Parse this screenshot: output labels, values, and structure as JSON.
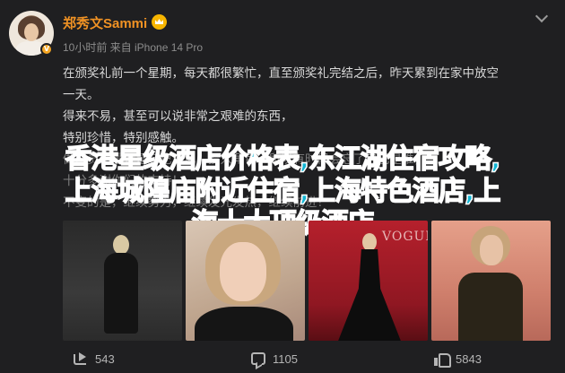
{
  "post": {
    "author": "郑秀文Sammi",
    "meta": "10小时前 来自 iPhone 14 Pro",
    "lines": [
      "在颁奖礼前一个星期，每天都很繁忙，直至颁奖礼完结之后，昨天累到在家中放空",
      "一天。",
      "得来不易，甚至可以说非常之艰难的东西，",
      "特别珍惜，特别感触。",
      "做演员最重要是忘记自己，投入角色，所以有时候会忘了自己是谁，",
      "十分多谢你们的支持！",
      "不变的是，继续努力，继续发光发热，继续前进！"
    ]
  },
  "overlay": {
    "line1": "香港星级酒店价格表,东江湖住宿攻略,",
    "line2": "上海城隍庙附近住宿,上海特色酒店,上",
    "line3": "海十大顶级酒店"
  },
  "photos": {
    "p3_brand": "VOGUE"
  },
  "actions": {
    "share_count": "543",
    "comment_count": "1105",
    "like_count": "5843"
  },
  "colors": {
    "accent": "#f09224",
    "overlay_text": "#13b5d4",
    "background": "#1f1f21"
  }
}
